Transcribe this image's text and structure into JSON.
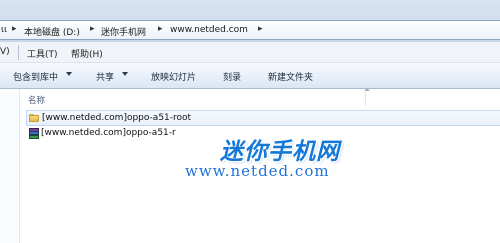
{
  "address_bar": {
    "crumbs": [
      {
        "label": "ιι"
      },
      {
        "label": "本地磁盘 (D:)"
      },
      {
        "label": "迷你手机网"
      },
      {
        "label": "www.netded.com"
      }
    ]
  },
  "menu_bar": {
    "items": [
      {
        "label": "V)"
      },
      {
        "label": "工具(T)"
      },
      {
        "label": "帮助(H)"
      }
    ]
  },
  "toolbar": {
    "include_library_label": "包含到库中",
    "share_label": "共享",
    "slideshow_label": "放映幻灯片",
    "burn_label": "刻录",
    "new_folder_label": "新建文件夹"
  },
  "file_list": {
    "column_name_header": "名称",
    "rows": [
      {
        "name": "[www.netded.com]oppo-a51-root",
        "type_icon": "folder-icon",
        "selected": true
      },
      {
        "name": "[www.netded.com]oppo-a51-r",
        "type_icon": "archive-icon",
        "selected": false
      }
    ]
  },
  "watermark": {
    "text": "迷你手机网",
    "url": "www.netded.com",
    "color": "#1478d8"
  },
  "colors": {
    "selection_border": "#c3d8ef",
    "toolbar_bg": "#dbe6f4"
  }
}
